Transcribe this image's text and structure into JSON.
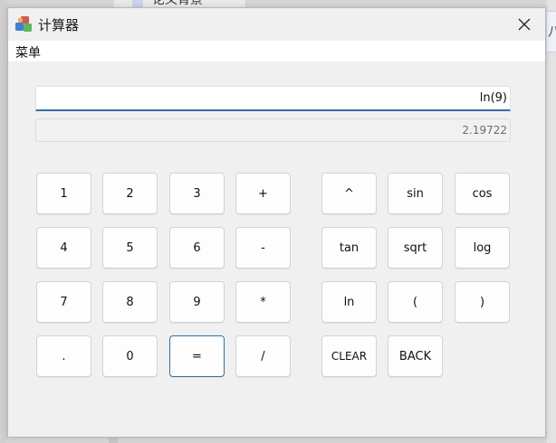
{
  "background": {
    "tab_fragment": "论义背景",
    "right_fragment": "八",
    "tab_icon": "document-icon"
  },
  "window": {
    "title": "计算器",
    "icon": "calculator-app-icon",
    "close_icon": "close-icon"
  },
  "menu": {
    "items": [
      "菜单"
    ]
  },
  "display": {
    "expression": "ln(9)",
    "result": "2.19722"
  },
  "keypad": {
    "numeric": [
      [
        "1",
        "2",
        "3",
        "+"
      ],
      [
        "4",
        "5",
        "6",
        "-"
      ],
      [
        "7",
        "8",
        "9",
        "*"
      ],
      [
        ".",
        "0",
        "=",
        "/"
      ]
    ],
    "functions": [
      [
        "^",
        "sin",
        "cos"
      ],
      [
        "tan",
        "sqrt",
        "log"
      ],
      [
        "ln",
        "(",
        ")"
      ],
      [
        "CLEAR",
        "BACK"
      ]
    ],
    "focused_key": "="
  },
  "colors": {
    "accent": "#2f6fb4",
    "window_bg": "#f0f0f0",
    "key_bg": "#fdfdfd"
  }
}
